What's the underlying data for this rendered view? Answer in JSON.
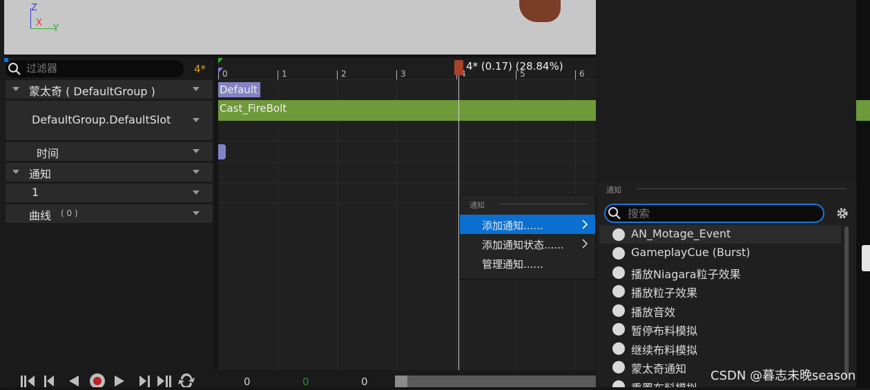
{
  "viewport": {
    "axis_z": "Z",
    "axis_x": "X",
    "axis_y": "Y"
  },
  "filter": {
    "placeholder": "过滤器",
    "count": "4*"
  },
  "tracks": {
    "montage": "蒙太奇 ( DefaultGroup )",
    "slot": "DefaultGroup.DefaultSlot",
    "time": "时间",
    "notify": "通知",
    "notify_track": "1",
    "curves": "曲线",
    "curves_count": "( 0 )"
  },
  "timeline": {
    "ruler": [
      "0",
      "1",
      "2",
      "3",
      "4",
      "5",
      "6"
    ],
    "playhead_label": "4* (0.17) (28.84%)",
    "section_label": "Default",
    "segment_label": "Cast_FireBolt",
    "segment_color": "#6f9a3a",
    "section_color": "#8383c4"
  },
  "bottom": {
    "v1": "0",
    "v2": "0",
    "v3": "0"
  },
  "context_menu": {
    "header": "通知",
    "items": [
      "添加通知......",
      "添加通知状态......",
      "管理通知......"
    ],
    "highlight_color": "#0b6fcf"
  },
  "picker": {
    "header": "通知",
    "search_placeholder": "搜索",
    "items": [
      "AN_Motage_Event",
      "GameplayCue (Burst)",
      "播放Niagara粒子效果",
      "播放粒子效果",
      "播放音效",
      "暂停布料模拟",
      "继续布料模拟",
      "蒙太奇通知",
      "重置布料模拟"
    ]
  },
  "watermark": "CSDN @暮志未晚season"
}
